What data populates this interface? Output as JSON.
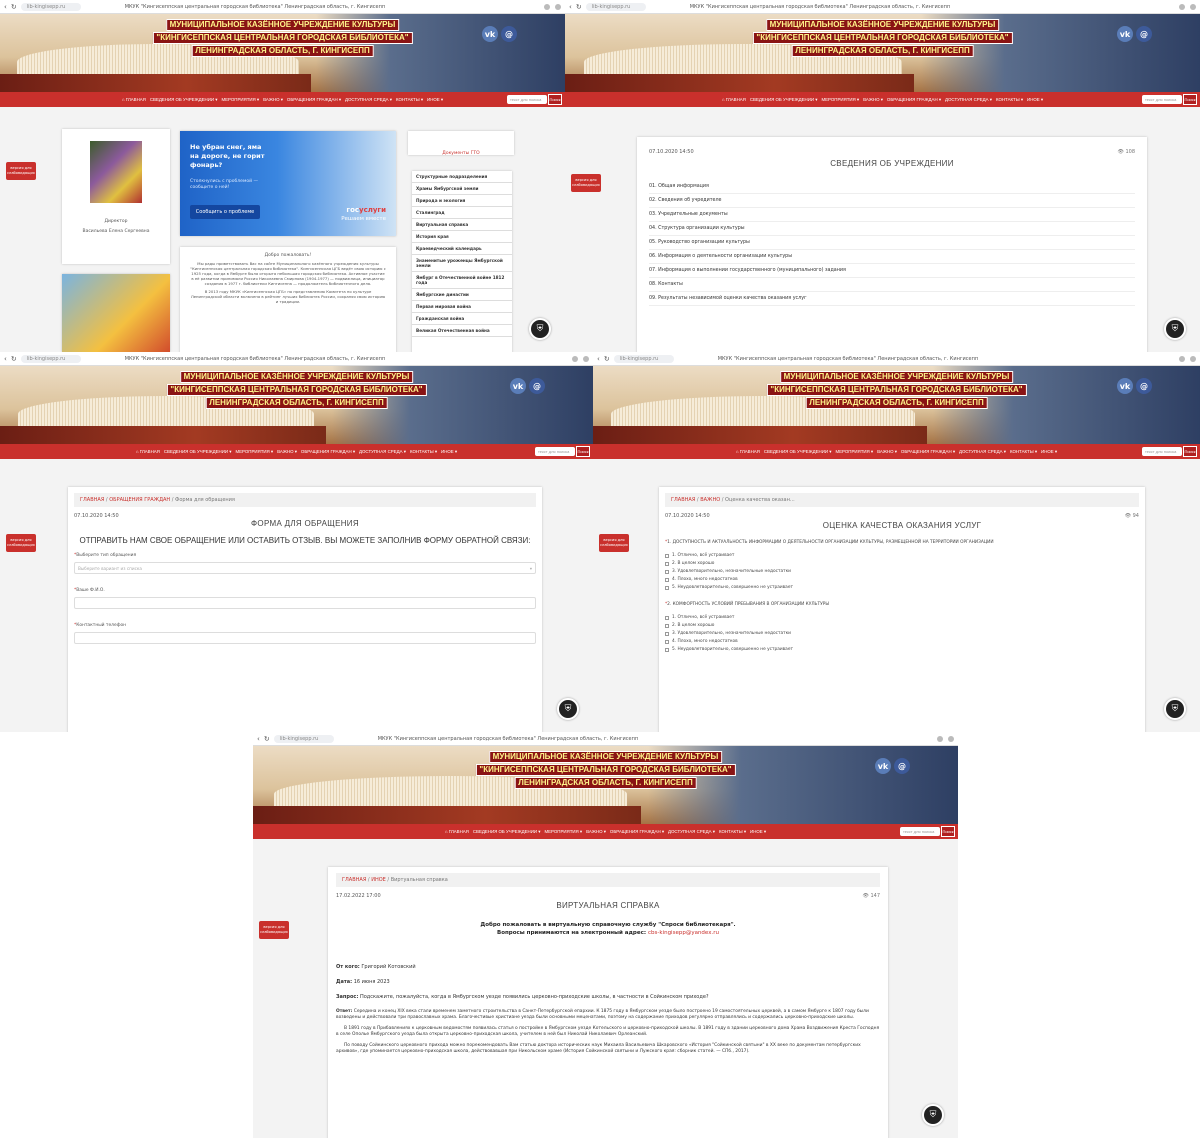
{
  "site": {
    "banner_lines": [
      "МУНИЦИПАЛЬНОЕ КАЗЁННОЕ УЧРЕЖДЕНИЕ КУЛЬТУРЫ",
      "\"КИНГИСЕППСКАЯ ЦЕНТРАЛЬНАЯ ГОРОДСКАЯ БИБЛИОТЕКА\"",
      "ЛЕНИНГРАДСКАЯ ОБЛАСТЬ, Г. КИНГИСЕПП"
    ],
    "vk": "vk",
    "mail": "@",
    "nav": [
      "⌂ ГЛАВНАЯ",
      "СВЕДЕНИЯ ОБ УЧРЕЖДЕНИИ ▾",
      "МЕРОПРИЯТИЯ ▾",
      "ВАЖНО ▾",
      "ОБРАЩЕНИЯ ГРАЖДАН ▾",
      "ДОСТУПНАЯ СРЕДА ▾",
      "КОНТАКТЫ ▾",
      "ИНОЕ ▾"
    ],
    "search_placeholder": "текст для поиска",
    "search_btn": "Поиск",
    "side_btn": "версия для слабовидящих",
    "gos_icon": "⛨"
  },
  "browser": {
    "url": "lib-kingisepp.ru",
    "title": "МКУК \"Кингисеппская центральная городская библиотека\" Ленинградская область, г. Кингисепп"
  },
  "s1": {
    "portrait_caption": "Директор",
    "director_name": "Васильева Елена Сергеевна",
    "promo_heading": "Не убран снег, яма на дороге, не горит фонарь?",
    "promo_sub": "Столкнулись с проблемой — сообщите о ней!",
    "promo_btn": "Сообщить о проблеме",
    "gos_logo": "гос",
    "gos_logo2": "услуги",
    "gos_tag": "Решаем вместе",
    "welcome": "Добро пожаловать!",
    "welcome_text": "Мы рады приветствовать Вас на сайте Муниципального казённого учреждения культуры \"Кингисеппская центральная городская библиотека\". Кингисеппская ЦГБ ведёт свою историю с 1925 года, когда в Ямбурге была открыта небольшая городская библиотека. Активное участие в её развитии принимали Россия Николаевна Смирнова (1904-1977) — подвижница, инициатор создания в 1977 г. библиотеки Кингисеппа — продолжатель библиотечного дела.",
    "welcome_text2": "В 2013 году МКУК «Кингисеппская ЦГБ» по представлению Комитета по культуре Ленинградской области включена в рейтинг лучших библиотек России, сохраняя свою историю и традиции.",
    "doc_link": "Документы ГТО",
    "side_list": [
      "Структурные подразделения",
      "Храмы Ямбургской земли",
      "Природа и экология",
      "Сталинград",
      "Виртуальная справка",
      "История края",
      "Краеведческий календарь",
      "Знаменитые уроженцы Ямбургской земли",
      "Ямбург в Отечественной войне 1812 года",
      "Ямбургские династии",
      "Первая мировая война",
      "Гражданская война",
      "Великая Отечественная война"
    ]
  },
  "s2": {
    "date": "07.10.2020 14:50",
    "views": "👁 108",
    "title": "СВЕДЕНИЯ ОБ УЧРЕЖДЕНИИ",
    "items": [
      "01. Общая информация",
      "02. Сведения об учредителе",
      "03. Учредительные документы",
      "04. Структура организации культуры",
      "05. Руководство организации культуры",
      "06. Информация о деятельности организации культуры",
      "07. Информация о выполнении государственного (муниципального) задания",
      "08. Контакты",
      "09. Результаты независимой оценки качества оказания услуг"
    ]
  },
  "s3": {
    "crumb_home": "ГЛАВНАЯ",
    "crumb_mid": "ОБРАЩЕНИЯ ГРАЖДАН",
    "crumb_cur": "Форма для обращения",
    "date": "07.10.2020 14:50",
    "title": "ФОРМА ДЛЯ ОБРАЩЕНИЯ",
    "heading": "ОТПРАВИТЬ НАМ СВОЕ ОБРАЩЕНИЕ ИЛИ ОСТАВИТЬ ОТЗЫВ. ВЫ МОЖЕТЕ ЗАПОЛНИВ ФОРМУ ОБРАТНОЙ СВЯЗИ:",
    "f1_label": "Выберите тип обращения",
    "f1_placeholder": "Выберите вариант из списка",
    "f2_label": "Ваше Ф.И.О.",
    "f3_label": "Контактный телефон"
  },
  "s4": {
    "crumb_home": "ГЛАВНАЯ",
    "crumb_mid": "ВАЖНО",
    "crumb_cur": "Оценка качества оказан...",
    "date": "07.10.2020 14:50",
    "views": "👁 94",
    "title": "ОЦЕНКА КАЧЕСТВА ОКАЗАНИЯ УСЛУГ",
    "q1": "1. ДОСТУПНОСТЬ И АКТУАЛЬНОСТЬ ИНФОРМАЦИИ О ДЕЯТЕЛЬНОСТИ ОРГАНИЗАЦИИ КУЛЬТУРЫ, РАЗМЕЩЕННОЙ НА ТЕРРИТОРИИ ОРГАНИЗАЦИИ",
    "q1_opts": [
      "1. Отлично, всё устраивает",
      "2. В целом хорошо",
      "3. Удовлетворительно, незначительные недостатки",
      "4. Плохо, много недостатков",
      "5. Неудовлетворительно, совершенно не устраивает"
    ],
    "q2": "2. КОМФОРТНОСТЬ УСЛОВИЙ ПРЕБЫВАНИЯ В ОРГАНИЗАЦИИ КУЛЬТУРЫ",
    "q2_opts": [
      "1. Отлично, всё устраивает",
      "2. В целом хорошо",
      "3. Удовлетворительно, незначительные недостатки",
      "4. Плохо, много недостатков",
      "5. Неудовлетворительно, совершенно не устраивает"
    ]
  },
  "s5": {
    "crumb_home": "ГЛАВНАЯ",
    "crumb_mid": "ИНОЕ",
    "crumb_cur": "Виртуальная справка",
    "date": "17.02.2022 17:00",
    "views": "👁 147",
    "title": "ВИРТУАЛЬНАЯ СПРАВКА",
    "intro1": "Добро пожаловать в виртуальную справочную службу \"Спроси библиотекаря\".",
    "intro2": "Вопросы принимаются на электронный адрес:",
    "email": "cbs-kingisepp@yandex.ru",
    "from_label": "От кого:",
    "from_val": "Григорий Котовский",
    "date_label": "Дата:",
    "date_val": "16 июня 2023",
    "q_label": "Запрос:",
    "q_val": "Подскажите, пожалуйста, когда в Ямбургском уезде появились церковно-приходские школы, в частности в Сойкинском приходе?",
    "a_label": "Ответ:",
    "a_val": "Середина и конец XIX века стали временем заметного строительства в Санкт-Петербургской епархии. К 1875 году в Ямбургском уезде было построено 19 самостоятельных церквей, а в самом Ямбурге к 1807 году были возведены и действовали три православных храма. Благочестивые христиане уезда были основными меценатами, поэтому на содержание приходов регулярно отправлялись и содержались церковно-приходские школы.",
    "p2": "В 1891 году в Прибавлениях к церковным ведомостям появилась статья о постройке в Ямбургском уезде Котельского и церковно-приходской школы. В 1891 году в здании церковного дома Храма Воздвижения Креста Господня в селе Ополье Ямбургского уезда была открыта церковно-приходская школа, учителем в ней был Николай Николаевич Орлеанский.",
    "p3": "По поводу Сойкинского церковного прихода можно порекомендовать Вам статью доктора исторических наук Михаила Васильевича Шкаровского «История \"Сойкинской святыни\" в XX веке по документам петербургских архивов», где упоминается церковно-приходская школа, действовавшая при Никольском храме (История Сойкинской святыни и Лужского края: сборник статей. — СПб., 2017)."
  }
}
